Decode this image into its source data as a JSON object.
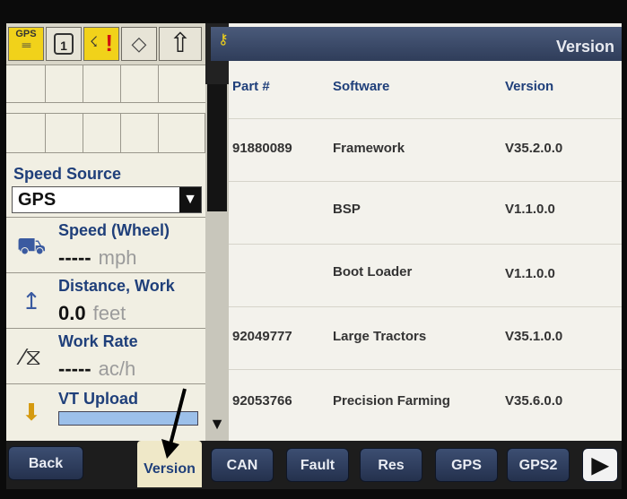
{
  "left": {
    "speed_source_label": "Speed Source",
    "speed_source_value": "GPS",
    "readouts": [
      {
        "title": "Speed (Wheel)",
        "value": "-----",
        "unit": "mph"
      },
      {
        "title": "Distance, Work",
        "value": "0.0",
        "unit": "feet"
      },
      {
        "title": "Work Rate",
        "value": "-----",
        "unit": "ac/h"
      },
      {
        "title": "VT Upload"
      }
    ],
    "status_icons": {
      "gps_label": "GPS",
      "cabinet_number": "1"
    }
  },
  "right": {
    "header_title": "Version",
    "columns": [
      "Part #",
      "Software",
      "Version"
    ],
    "rows": [
      {
        "part": "91880089",
        "software": "Framework",
        "version": "V35.2.0.0"
      },
      {
        "part": "",
        "software": "BSP",
        "version": "V1.1.0.0"
      },
      {
        "part": "",
        "software": "Boot Loader",
        "version": "V1.1.0.0"
      },
      {
        "part": "92049777",
        "software": "Large Tractors",
        "version": "V35.1.0.0"
      },
      {
        "part": "92053766",
        "software": "Precision Farming",
        "version": "V35.6.0.0"
      }
    ]
  },
  "bottom": {
    "back": "Back",
    "version": "Version",
    "can": "CAN",
    "fault": "Fault",
    "res": "Res",
    "gps": "GPS",
    "gps2": "GPS2"
  },
  "icons": [
    "gps-status-icon",
    "cabinet-icon",
    "alarm-icon",
    "book-icon",
    "up-arrow-icon",
    "tractor-icon",
    "distance-icon",
    "work-rate-icon",
    "upload-icon",
    "key-icon",
    "scroll-down-icon",
    "next-arrow-icon"
  ]
}
